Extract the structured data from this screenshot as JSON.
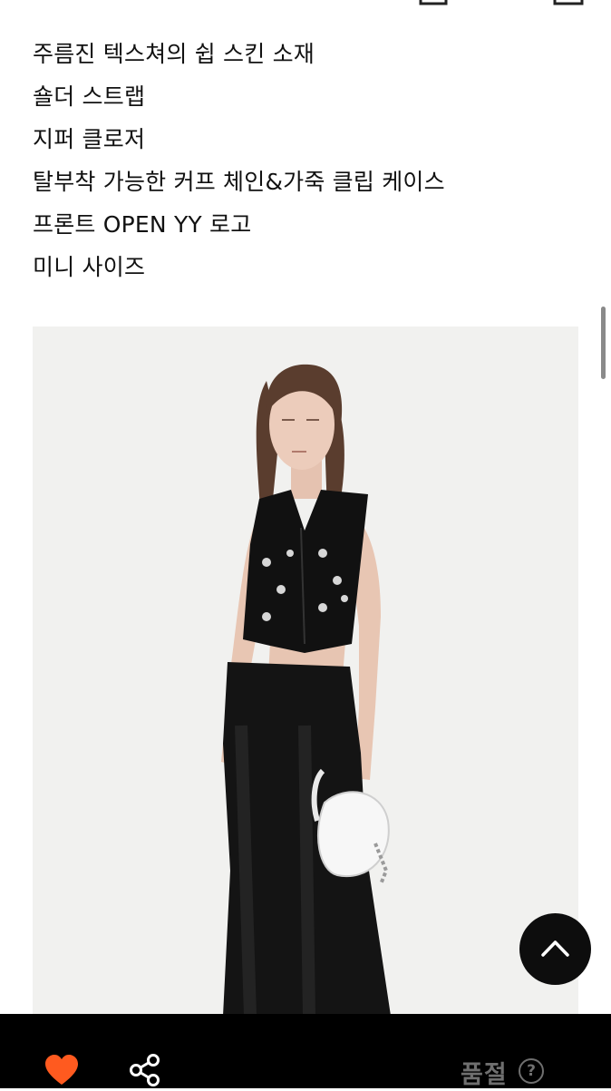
{
  "header": {
    "icons": [
      "bag-icon",
      "search-icon",
      "menu-icon"
    ]
  },
  "description": {
    "lines": [
      "주름진 텍스쳐의 쉽 스킨 소재",
      "숄더 스트랩",
      "지퍼 클로저",
      "탈부착 가능한 커프 체인&가죽 클립 케이스",
      "프론트 OPEN YY 로고",
      "미니 사이즈"
    ]
  },
  "product_image": {
    "subject": "model-wearing-black-vest-and-sheer-skirt-holding-white-bag"
  },
  "scroll_top_button": {
    "icon": "chevron-up-icon"
  },
  "bottom_bar": {
    "like_icon": "heart-icon",
    "like_color": "#ff5a1f",
    "share_icon": "share-icon",
    "status_label": "품절",
    "status_color": "#6f6f6f",
    "help_label": "?"
  }
}
